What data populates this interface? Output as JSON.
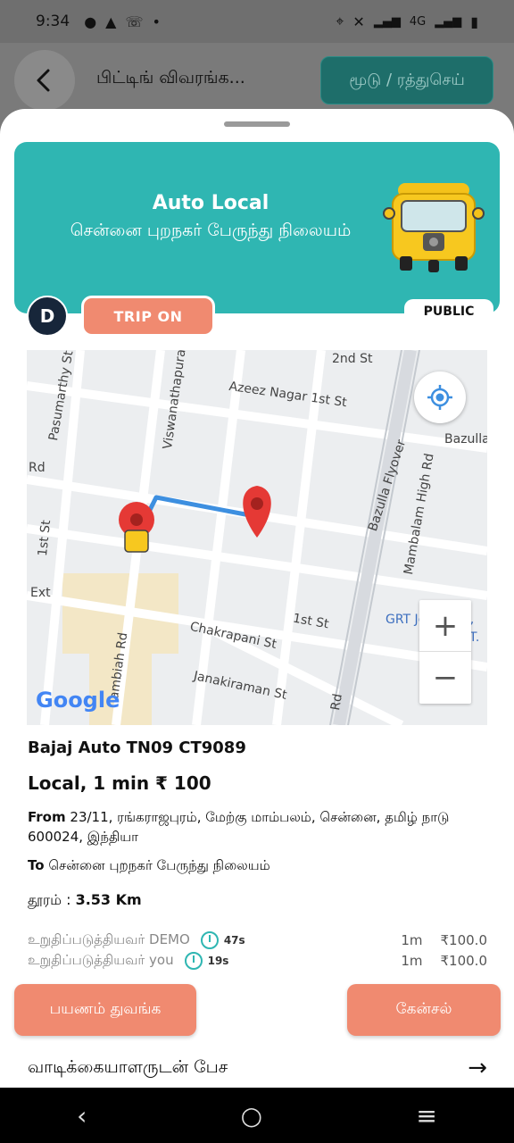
{
  "status_bar": {
    "time": "9:34",
    "left_icons": [
      "message-icon",
      "warning-icon",
      "missed-call-icon",
      "dot-icon"
    ],
    "right_icons": [
      "location-icon",
      "mute-icon",
      "volte-icon",
      "signal-icon",
      "network-4g",
      "signal-icon",
      "battery-icon"
    ],
    "network": "4G"
  },
  "appbar": {
    "title": "பிட்டிங் விவரங்க...",
    "action": "மூடு / ரத்துசெய்"
  },
  "banner": {
    "title": "Auto Local",
    "subtitle": "சென்னை புறநகர் பேருந்து நிலையம்",
    "image_icon": "auto-rickshaw-icon"
  },
  "avatar_letter": "D",
  "trip_status": "TRIP ON",
  "visibility": "PUBLIC",
  "map": {
    "labels": {
      "street1": "Pasumarthy St",
      "street2": "Viswanathapura",
      "street3": "2nd St",
      "street4": "Azeez Nagar 1st St",
      "street5": "Bazulla",
      "street6": "Rd",
      "street7": "Bazulla Flyover",
      "street8": "Mambalam High Rd",
      "street9": "1st St",
      "street10": "Ext",
      "street11": "1st St",
      "street12": "GRT Jewellers,",
      "street13": "Road, T.",
      "street14": "Chakrapani St",
      "street15": "Janakiraman St",
      "street16": "ambiah Rd",
      "street17": "Rd"
    },
    "zoom_in": "+",
    "zoom_out": "−",
    "google": "Google"
  },
  "trip": {
    "vehicle": "Bajaj Auto TN09 CT9089",
    "summary": "Local, 1 min  ₹ 100",
    "from_label": "From",
    "from_text": "23/11, ரங்கராஜபுரம், மேற்கு மாம்பலம், சென்னை, தமிழ் நாடு 600024, இந்தியா",
    "to_label": "To",
    "to_text": "சென்னை புறநகர் பேருந்து நிலையம்",
    "distance_label": "தூரம் :",
    "distance_value": "3.53 Km"
  },
  "confirmations": [
    {
      "label": "உறுதிப்படுத்தியவர் DEMO",
      "seconds": "47s",
      "duration": "1m",
      "price": "₹100.0"
    },
    {
      "label": "உறுதிப்படுத்தியவர் you",
      "seconds": "19s",
      "duration": "1m",
      "price": "₹100.0"
    }
  ],
  "buttons": {
    "start": "பயணம் துவங்க",
    "cancel": "கேன்சல்"
  },
  "chat": {
    "label": "வாடிக்கையாளருடன் பேச",
    "arrow": "→"
  },
  "navbar": {
    "back": "‹",
    "home": "○",
    "menu": "≡"
  },
  "colors": {
    "accent": "#2fb6b2",
    "button": "#f08a70",
    "route": "#3d8fe0",
    "pin": "#e53935"
  }
}
